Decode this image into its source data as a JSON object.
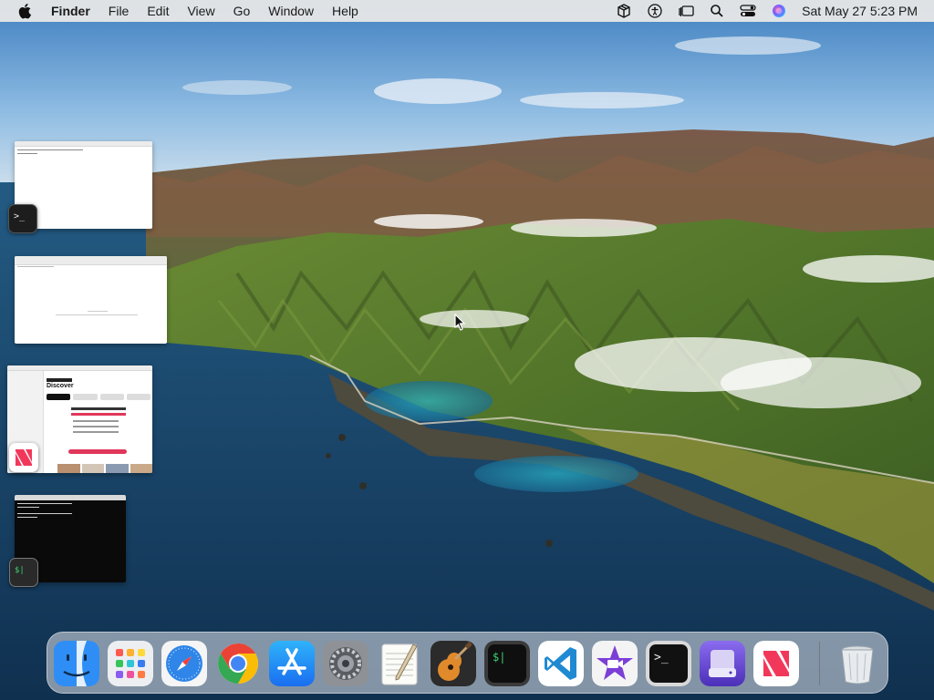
{
  "menubar": {
    "apple_icon": "apple-logo-icon",
    "app_name": "Finder",
    "menus": [
      "File",
      "Edit",
      "View",
      "Go",
      "Window",
      "Help"
    ],
    "status_icons": [
      "package-icon",
      "accessibility-icon",
      "stage-manager-icon",
      "search-icon",
      "control-center-icon",
      "siri-icon"
    ],
    "clock": "Sat May 27  5:23 PM"
  },
  "stage_manager": {
    "windows": [
      {
        "app": "Terminal",
        "badge_icon": "terminal-icon",
        "theme": "light"
      },
      {
        "app": "TextEdit",
        "badge_icon": "",
        "theme": "light"
      },
      {
        "app": "News",
        "badge_icon": "news-icon",
        "theme": "light",
        "preview_heading": "Discover"
      },
      {
        "app": "iTerm",
        "badge_icon": "iterm-icon",
        "theme": "dark"
      }
    ]
  },
  "dock": {
    "apps": [
      {
        "name": "Finder",
        "icon": "finder-icon"
      },
      {
        "name": "Launchpad",
        "icon": "launchpad-icon"
      },
      {
        "name": "Safari",
        "icon": "safari-icon"
      },
      {
        "name": "Google Chrome",
        "icon": "chrome-icon"
      },
      {
        "name": "App Store",
        "icon": "app-store-icon"
      },
      {
        "name": "System Preferences",
        "icon": "system-preferences-icon"
      },
      {
        "name": "TextEdit",
        "icon": "textedit-icon"
      },
      {
        "name": "GarageBand",
        "icon": "garageband-icon"
      },
      {
        "name": "iTerm",
        "icon": "iterm-icon"
      },
      {
        "name": "Visual Studio Code",
        "icon": "vscode-icon"
      },
      {
        "name": "iMovie",
        "icon": "imovie-icon"
      },
      {
        "name": "Terminal",
        "icon": "terminal-icon"
      },
      {
        "name": "Disk Utility",
        "icon": "disk-utility-icon"
      },
      {
        "name": "News",
        "icon": "news-icon"
      },
      {
        "name": "Trash",
        "icon": "trash-icon"
      }
    ]
  },
  "colors": {
    "menubar_bg": "#ECEAE8",
    "sky": "#6FA6D6",
    "ocean": "#1E4F7A",
    "hills": "#5E7F33"
  }
}
